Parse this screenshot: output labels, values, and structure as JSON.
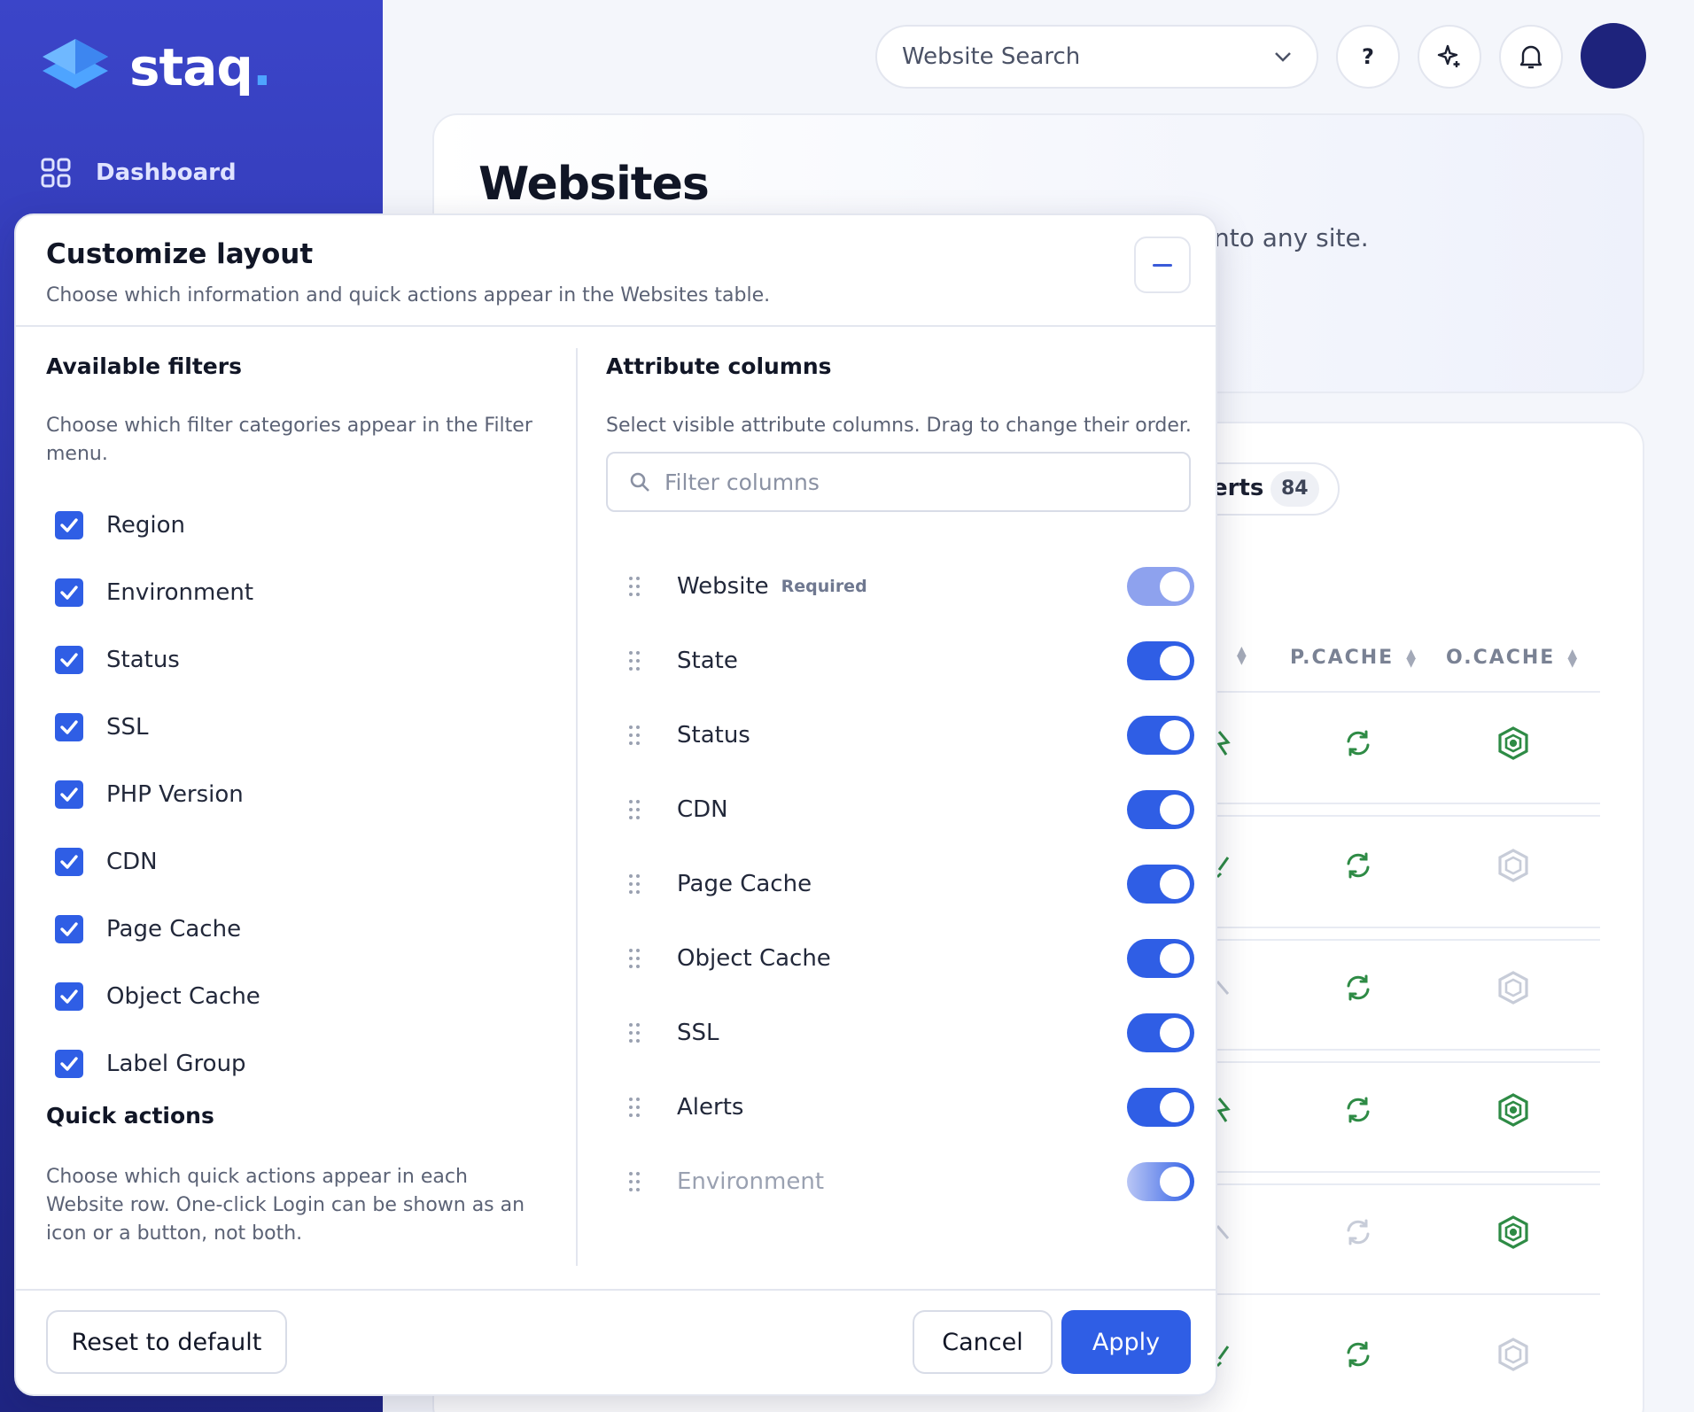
{
  "brand": {
    "name": "staq",
    "dot": "."
  },
  "nav": {
    "dashboard_label": "Dashboard"
  },
  "topbar": {
    "search_label": "Website Search",
    "help_label": "?"
  },
  "page": {
    "title": "Websites",
    "subtitle_fragment": "nto any site."
  },
  "table": {
    "alerts_tab_label": "erts",
    "alerts_count": "84",
    "columns": [
      "P.CACHE",
      "O.CACHE"
    ]
  },
  "modal": {
    "title": "Customize layout",
    "subtitle": "Choose which information and quick actions appear in the Websites table.",
    "filters": {
      "title": "Available filters",
      "description": "Choose which filter categories appear in the Filter menu.",
      "items": [
        "Region",
        "Environment",
        "Status",
        "SSL",
        "PHP Version",
        "CDN",
        "Page Cache",
        "Object Cache",
        "Label Group"
      ]
    },
    "quick_actions": {
      "title": "Quick actions",
      "description": "Choose which quick actions appear in each Website row. One-click Login can be shown as an icon or a button, not both."
    },
    "columns": {
      "title": "Attribute columns",
      "description": "Select visible attribute columns. Drag to change their order.",
      "filter_placeholder": "Filter columns",
      "required_label": "Required",
      "items": [
        "Website",
        "State",
        "Status",
        "CDN",
        "Page Cache",
        "Object Cache",
        "SSL",
        "Alerts",
        "Environment"
      ]
    },
    "buttons": {
      "reset": "Reset to default",
      "cancel": "Cancel",
      "apply": "Apply"
    }
  },
  "colors": {
    "accent": "#2f5ee5",
    "sidebar": "#2c33a8",
    "success": "#2e8b45"
  }
}
